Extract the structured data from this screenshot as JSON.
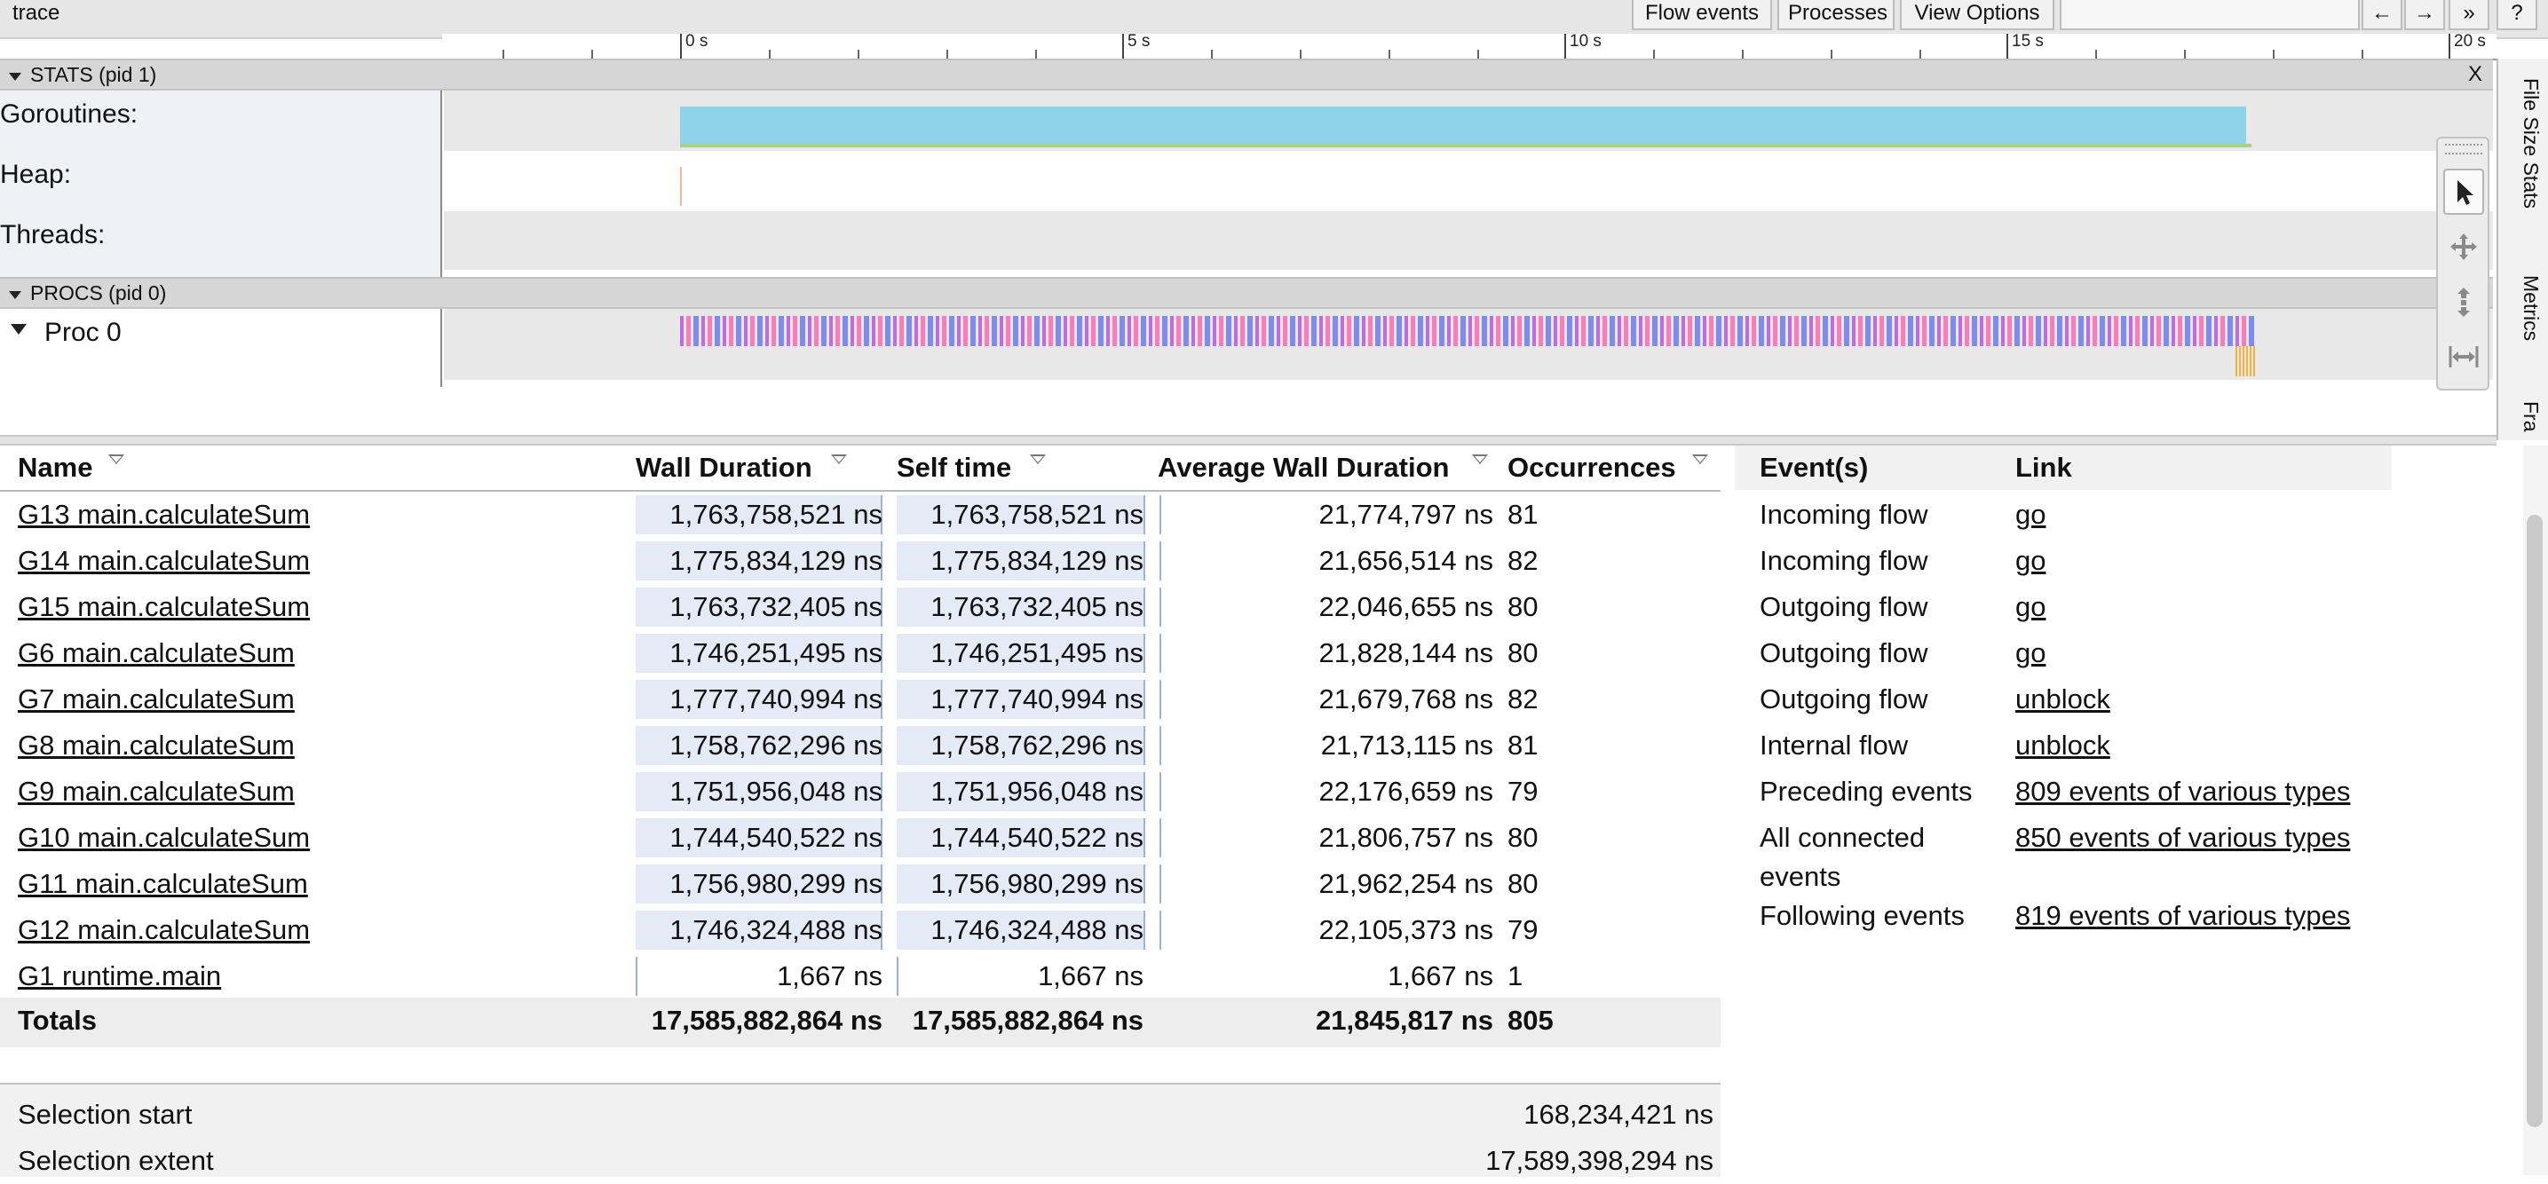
{
  "app": {
    "title": "trace"
  },
  "toolbar": {
    "flow_events": "Flow events",
    "processes": "Processes",
    "view_options": "View Options",
    "nav_back": "←",
    "nav_forward": "→",
    "more": "»",
    "help": "?"
  },
  "ruler": {
    "ticks": [
      "0 s",
      "5 s",
      "10 s",
      "15 s",
      "20 s"
    ]
  },
  "stats": {
    "header": "STATS (pid 1)",
    "close": "X",
    "tracks": [
      "Goroutines:",
      "Heap:",
      "Threads:"
    ]
  },
  "procs": {
    "header": "PROCS (pid 0)",
    "track": "Proc 0"
  },
  "sidebar": {
    "tabs": [
      "File Size Stats",
      "Metrics",
      "Fra"
    ]
  },
  "tools": [
    "select-tool",
    "pan-tool",
    "zoom-tool",
    "timing-tool"
  ],
  "table": {
    "headers": {
      "name": "Name",
      "wall": "Wall Duration",
      "self": "Self time",
      "avg": "Average Wall Duration",
      "occ": "Occurrences"
    },
    "rows": [
      {
        "name": "G13 main.calculateSum",
        "wall": "1,763,758,521 ns",
        "self": "1,763,758,521 ns",
        "avg": "21,774,797 ns",
        "occ": "81"
      },
      {
        "name": "G14 main.calculateSum",
        "wall": "1,775,834,129 ns",
        "self": "1,775,834,129 ns",
        "avg": "21,656,514 ns",
        "occ": "82"
      },
      {
        "name": "G15 main.calculateSum",
        "wall": "1,763,732,405 ns",
        "self": "1,763,732,405 ns",
        "avg": "22,046,655 ns",
        "occ": "80"
      },
      {
        "name": "G6 main.calculateSum",
        "wall": "1,746,251,495 ns",
        "self": "1,746,251,495 ns",
        "avg": "21,828,144 ns",
        "occ": "80"
      },
      {
        "name": "G7 main.calculateSum",
        "wall": "1,777,740,994 ns",
        "self": "1,777,740,994 ns",
        "avg": "21,679,768 ns",
        "occ": "82"
      },
      {
        "name": "G8 main.calculateSum",
        "wall": "1,758,762,296 ns",
        "self": "1,758,762,296 ns",
        "avg": "21,713,115 ns",
        "occ": "81"
      },
      {
        "name": "G9 main.calculateSum",
        "wall": "1,751,956,048 ns",
        "self": "1,751,956,048 ns",
        "avg": "22,176,659 ns",
        "occ": "79"
      },
      {
        "name": "G10 main.calculateSum",
        "wall": "1,744,540,522 ns",
        "self": "1,744,540,522 ns",
        "avg": "21,806,757 ns",
        "occ": "80"
      },
      {
        "name": "G11 main.calculateSum",
        "wall": "1,756,980,299 ns",
        "self": "1,756,980,299 ns",
        "avg": "21,962,254 ns",
        "occ": "80"
      },
      {
        "name": "G12 main.calculateSum",
        "wall": "1,746,324,488 ns",
        "self": "1,746,324,488 ns",
        "avg": "22,105,373 ns",
        "occ": "79"
      },
      {
        "name": "G1 runtime.main",
        "wall": "1,667 ns",
        "self": "1,667 ns",
        "avg": "1,667 ns",
        "occ": "1"
      }
    ],
    "totals": {
      "label": "Totals",
      "wall": "17,585,882,864 ns",
      "self": "17,585,882,864 ns",
      "avg": "21,845,817 ns",
      "occ": "805"
    }
  },
  "selection": {
    "start_label": "Selection start",
    "start_value": "168,234,421 ns",
    "extent_label": "Selection extent",
    "extent_value": "17,589,398,294 ns"
  },
  "flows": {
    "headers": {
      "events": "Event(s)",
      "link": "Link"
    },
    "rows": [
      {
        "label": "Incoming flow",
        "link": "go"
      },
      {
        "label": "Incoming flow",
        "link": "go"
      },
      {
        "label": "Outgoing flow",
        "link": "go"
      },
      {
        "label": "Outgoing flow",
        "link": "go"
      },
      {
        "label": "Outgoing flow",
        "link": "unblock"
      },
      {
        "label": "Internal flow",
        "link": "unblock"
      },
      {
        "label": "Preceding events",
        "link": "809 events of various types"
      },
      {
        "label": "All connected events",
        "link": "850 events of various types"
      },
      {
        "label": "Following events",
        "link": "819 events of various types"
      }
    ]
  },
  "colors": {
    "goroutines": "#8fd3e8",
    "proc_a": "#c06be0",
    "proc_b": "#ff7ab8",
    "proc_c": "#7c8cf0",
    "bar_fill": "#e4ebf6"
  }
}
